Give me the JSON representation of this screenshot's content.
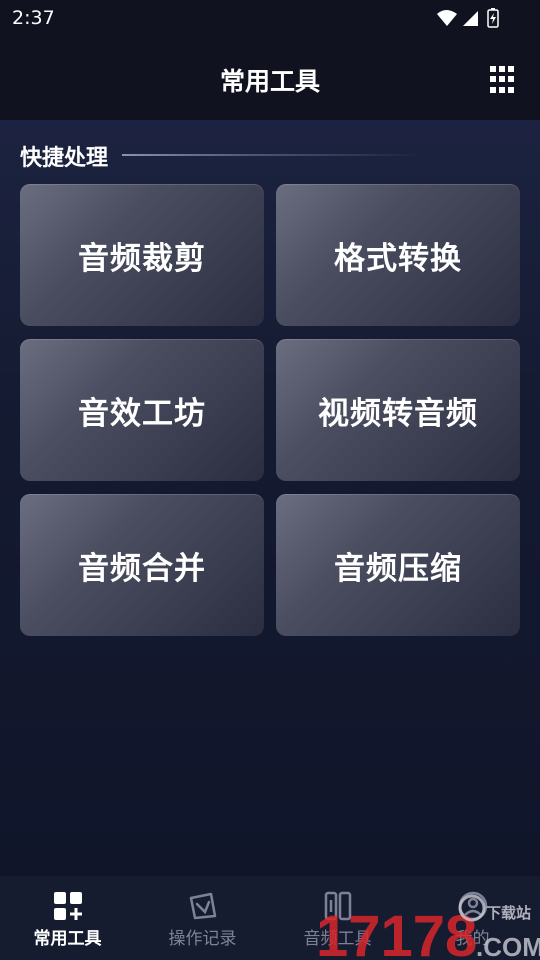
{
  "status_bar": {
    "time": "2:37"
  },
  "header": {
    "title": "常用工具"
  },
  "section": {
    "title": "快捷处理"
  },
  "tools": [
    {
      "label": "音频裁剪"
    },
    {
      "label": "格式转换"
    },
    {
      "label": "音效工坊"
    },
    {
      "label": "视频转音频"
    },
    {
      "label": "音频合并"
    },
    {
      "label": "音频压缩"
    }
  ],
  "bottom_nav": {
    "items": [
      {
        "label": "常用工具",
        "icon": "grid-plus-icon",
        "active": true
      },
      {
        "label": "操作记录",
        "icon": "record-icon",
        "active": false
      },
      {
        "label": "音频工具",
        "icon": "audio-tool-icon",
        "active": false
      },
      {
        "label": "我的",
        "icon": "profile-icon",
        "active": false
      }
    ]
  },
  "watermark": {
    "number": "17178",
    "domain": ".COM",
    "tagline": "下载站"
  },
  "colors": {
    "background": "#12172a",
    "header": "#10131f",
    "card": "#4a4e60",
    "nav_inactive": "#7d8296",
    "watermark_red": "#d9262b"
  }
}
